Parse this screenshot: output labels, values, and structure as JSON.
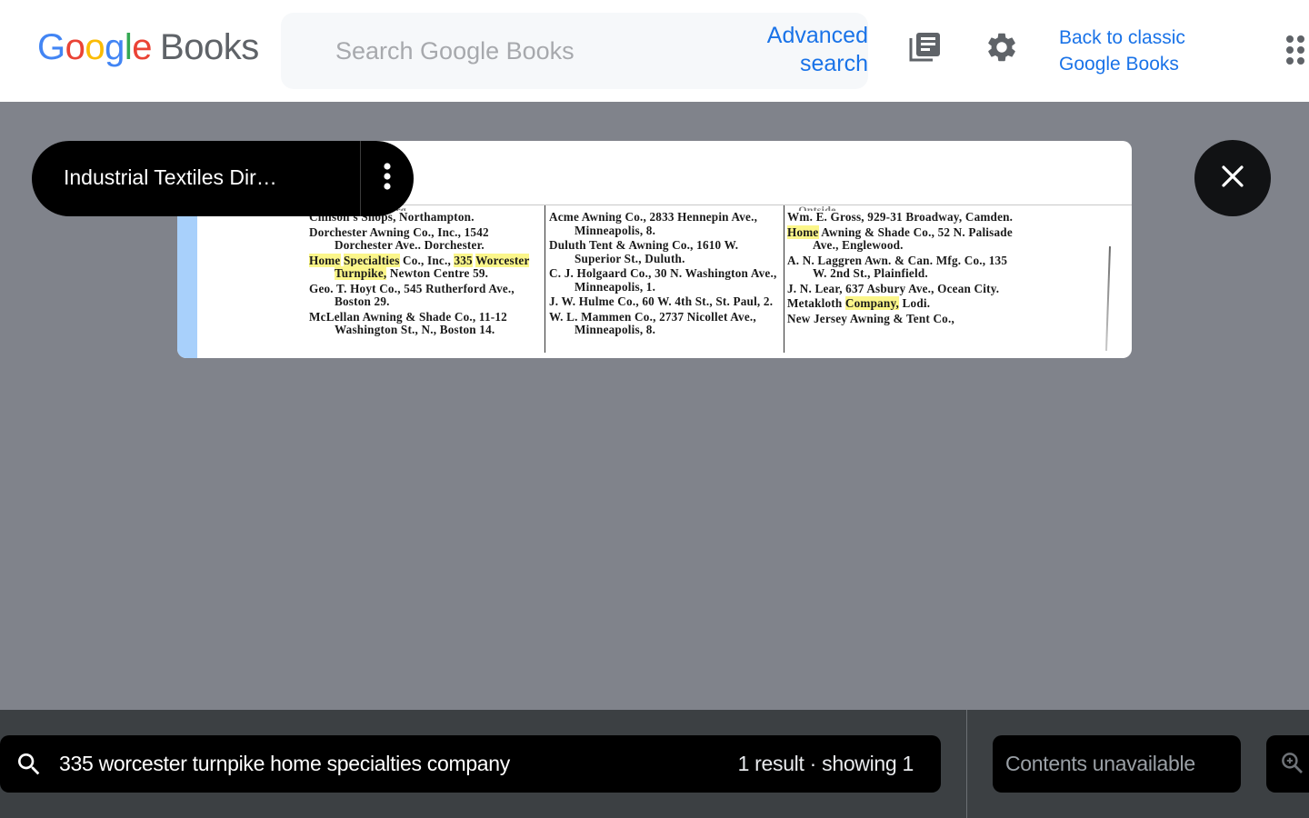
{
  "header": {
    "logo_letters": [
      "G",
      "o",
      "o",
      "g",
      "l",
      "e"
    ],
    "logo_product": "Books",
    "search_placeholder": "Search Google Books",
    "search_value": "",
    "advanced_search_line1": "Advanced",
    "advanced_search_line2": "search",
    "library_icon": "my-library-icon",
    "settings_icon": "gear-icon",
    "back_to_classic_line1": "Back to classic",
    "back_to_classic_line2": "Google Books",
    "apps_icon": "apps-grid-icon"
  },
  "colors": {
    "link_blue": "#1a73e8",
    "highlight_yellow": "#fbf68a",
    "page_strip_blue": "#a8d0fb",
    "viewer_background": "#80838b",
    "bottom_bar": "#3c4043"
  },
  "viewer": {
    "book_title": "Industrial Textiles Dir…",
    "more_options_icon": "more-vert-icon",
    "close_icon": "close-icon",
    "page": {
      "columns": [
        {
          "cut_top": "…thorne, Fitchburg.",
          "entries": [
            {
              "parts": [
                {
                  "t": "Chilson's Shops, Northampton.",
                  "hl": false
                }
              ]
            },
            {
              "parts": [
                {
                  "t": "Dorchester Awning Co., Inc., 1542 Dorchester Ave.. Dorchester.",
                  "hl": false
                }
              ]
            },
            {
              "parts": [
                {
                  "t": "Home",
                  "hl": true
                },
                {
                  "t": " ",
                  "hl": false
                },
                {
                  "t": "Specialties",
                  "hl": true
                },
                {
                  "t": " Co., Inc., ",
                  "hl": false
                },
                {
                  "t": "335",
                  "hl": true
                },
                {
                  "t": " ",
                  "hl": false
                },
                {
                  "t": "Worcester",
                  "hl": true
                },
                {
                  "t": " ",
                  "hl": false
                },
                {
                  "t": "Turnpike,",
                  "hl": true
                },
                {
                  "t": " Newton Centre 59.",
                  "hl": false
                }
              ]
            },
            {
              "parts": [
                {
                  "t": "Geo. T. Hoyt Co., 545 Rutherford Ave., Boston 29.",
                  "hl": false
                }
              ]
            },
            {
              "parts": [
                {
                  "t": "McLellan Awning & Shade Co., 11-12 Washington St., N., Boston 14.",
                  "hl": false
                }
              ]
            }
          ]
        },
        {
          "cut_top": "",
          "entries": [
            {
              "parts": [
                {
                  "t": "Acme Awning Co., 2833 Hennepin Ave., Minneapolis, 8.",
                  "hl": false
                }
              ]
            },
            {
              "parts": [
                {
                  "t": "Duluth Tent & Awning Co., 1610 W. Superior St., Duluth.",
                  "hl": false
                }
              ]
            },
            {
              "parts": [
                {
                  "t": "C. J. Holgaard Co., 30 N. Washington Ave., Minneapolis, 1.",
                  "hl": false
                }
              ]
            },
            {
              "parts": [
                {
                  "t": "J. W. Hulme Co., 60 W. 4th St., St. Paul, 2.",
                  "hl": false
                }
              ]
            },
            {
              "parts": [
                {
                  "t": "W. L. Mammen Co., 2737 Nicollet Ave., Minneapolis, 8.",
                  "hl": false
                }
              ]
            }
          ]
        },
        {
          "cut_top": "…Ontside.",
          "entries": [
            {
              "parts": [
                {
                  "t": "Wm. E. Gross, 929-31 Broadway, Camden.",
                  "hl": false
                }
              ]
            },
            {
              "parts": [
                {
                  "t": "Home",
                  "hl": true
                },
                {
                  "t": " Awning & Shade Co., 52 N. Palisade Ave., Englewood.",
                  "hl": false
                }
              ]
            },
            {
              "parts": [
                {
                  "t": "A. N. Laggren Awn. & Can. Mfg. Co., 135 W. 2nd St., Plainfield.",
                  "hl": false
                }
              ]
            },
            {
              "parts": [
                {
                  "t": "J. N. Lear, 637 Asbury Ave., Ocean City.",
                  "hl": false
                }
              ]
            },
            {
              "parts": [
                {
                  "t": "Metakloth ",
                  "hl": false
                },
                {
                  "t": "Company,",
                  "hl": true
                },
                {
                  "t": " Lodi.",
                  "hl": false
                }
              ]
            },
            {
              "parts": [
                {
                  "t": "New Jersey Awning & Tent Co.,",
                  "hl": false
                }
              ]
            }
          ]
        }
      ]
    }
  },
  "bottom_bar": {
    "search_icon": "search-icon",
    "query": "335 worcester turnpike home specialties company",
    "result_count": "1 result · showing 1",
    "contents": "Contents unavailable",
    "zoom_icon": "zoom-in-icon"
  }
}
